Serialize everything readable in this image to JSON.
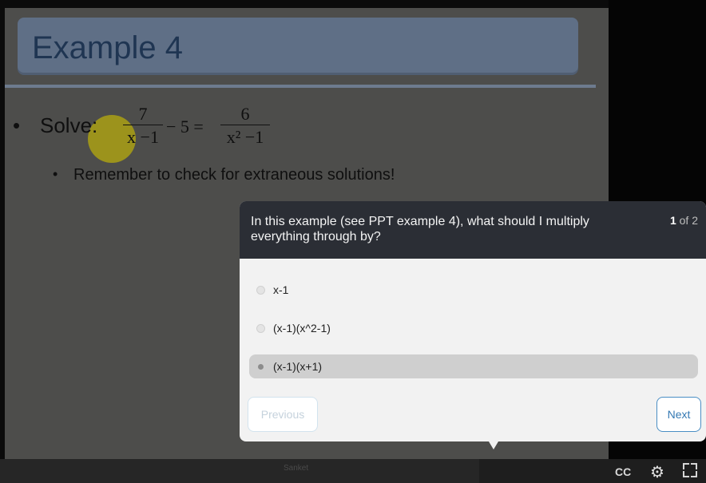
{
  "slide": {
    "title": "Example 4",
    "bullet_symbol": "•",
    "solve_label": "Solve:",
    "equation": {
      "frac1_num": "7",
      "frac1_den": "x −1",
      "middle": "− 5 =",
      "frac2_num": "6",
      "frac2_den": "x² −1"
    },
    "sub_bullet_symbol": "•",
    "sub_bullet_text": "Remember to check for extraneous solutions!"
  },
  "player": {
    "center_label": "Sanket",
    "cc_label": "CC",
    "gear_icon": "gear-icon",
    "fullscreen_icon": "fullscreen-icon"
  },
  "quiz": {
    "question": "In this example (see PPT example 4), what should I multiply everything through by?",
    "counter_current": "1",
    "counter_text": "of 2",
    "options": [
      {
        "label": "x-1",
        "selected": false
      },
      {
        "label": "(x-1)(x^2-1)",
        "selected": false
      },
      {
        "label": "(x-1)(x+1)",
        "selected": true
      }
    ],
    "previous_label": "Previous",
    "next_label": "Next"
  },
  "colors": {
    "header_bg": "#2b2e35",
    "next_accent": "#3479b3",
    "slide_title": "#1f3552"
  }
}
